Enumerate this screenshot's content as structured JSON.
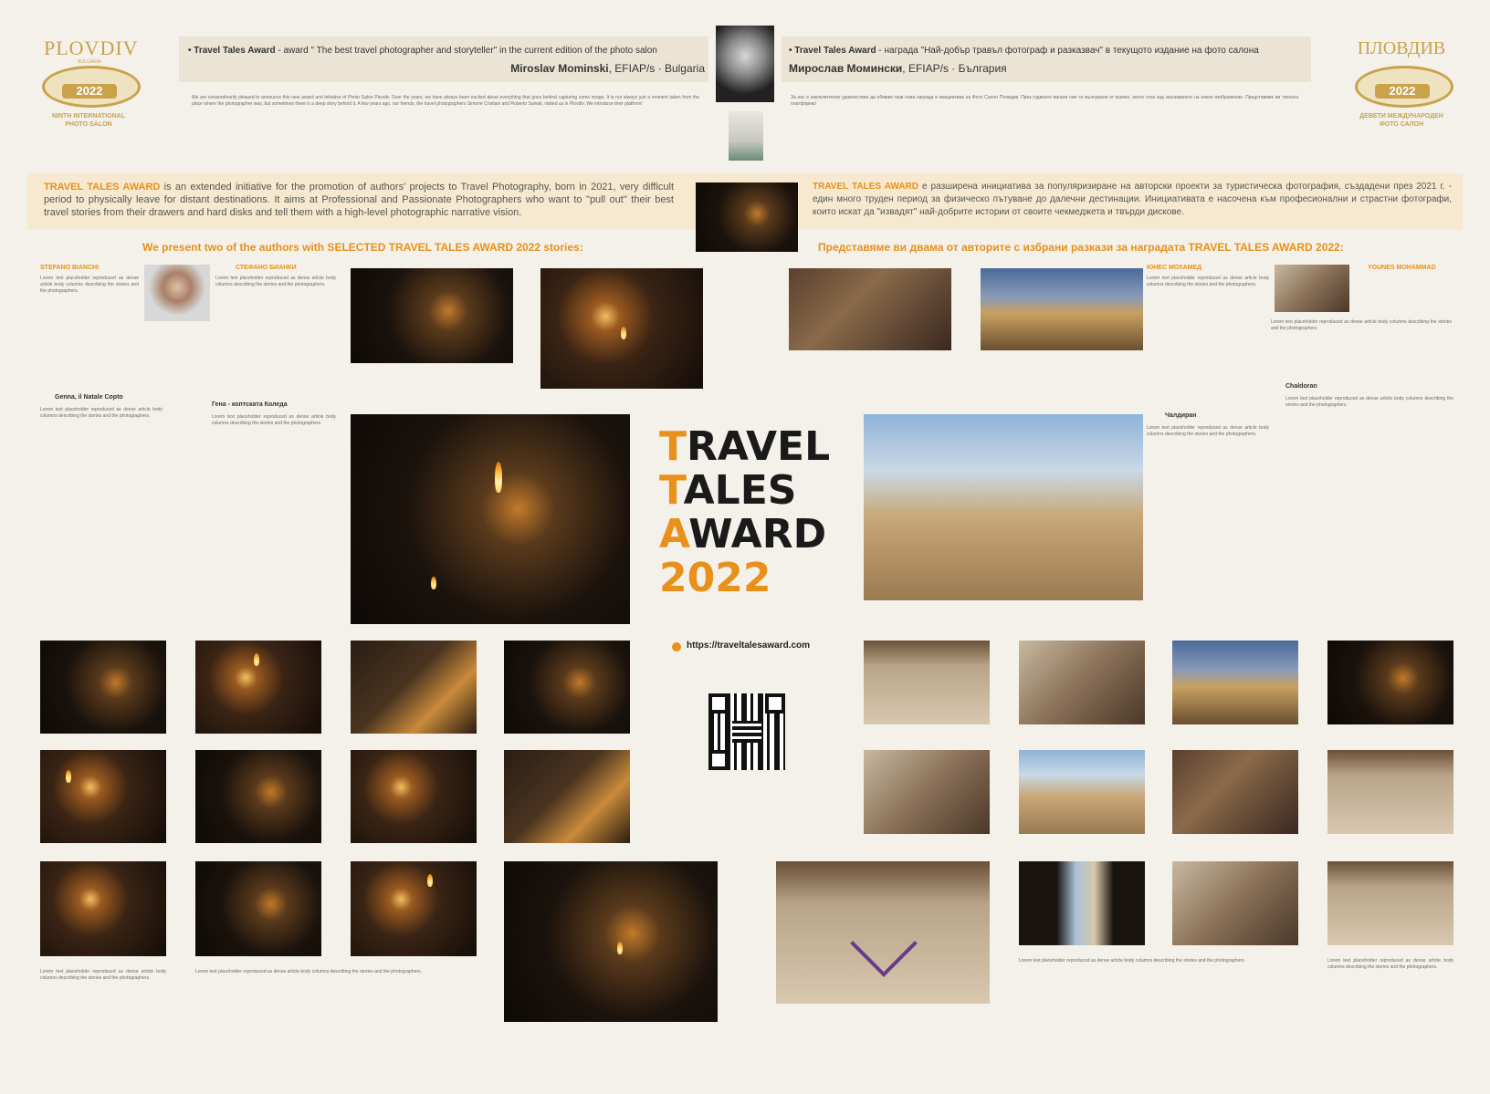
{
  "colors": {
    "accent": "#e8901a",
    "gold": "#c9a24a",
    "dark": "#222222",
    "paper": "#f4f1ea",
    "text": "#6a6a6a"
  },
  "left_logo": {
    "city": "PLOVDIV",
    "country": "BULGARIA",
    "year": "2022",
    "caption_line1": "NINTH INTERNATIONAL",
    "caption_line2": "PHOTO SALON"
  },
  "right_logo": {
    "city": "ПЛОВДИВ",
    "year": "2022",
    "caption_line1": "ДЕВЕТИ МЕЖДУНАРОДЕН",
    "caption_line2": "ФОТО САЛОН"
  },
  "header_en": {
    "award": "• Travel Tales Award",
    "desc": "- award \" The best travel photographer and storyteller\" in the current edition of the photo salon",
    "name": "Miroslav Mominski",
    "title": ", EFIAP/s · Bulgaria"
  },
  "header_bg": {
    "award": "• Travel Tales Award",
    "desc": "- награда \"Най-добър травъл фотограф и разказвач\" в текущото издание на фото салона",
    "name": "Мирослав Момински",
    "title": ", EFIAP/s · България"
  },
  "intro_en": "We are extraordinarily pleased to announce this new award and initiative of Photo Salon Plovdiv. Over the years, we have always been excited about everything that goes behind capturing some image. It is not always just a moment taken from the place where the photographer was, but sometimes there is a deep story behind it. A few years ago, our friends, the travel photographers Simone Cristiani and Roberto Salvati, visited us in Plovdiv. We introduce their platform!",
  "intro_bg": "За нас е изключително удоволствие да обявим тази нова награда и инициатива на Фото Салон Пловдив. През годините винаги сме се вълнували от всичко, което стои зад заснемането на някое изображение. Представяме ви тяхната платформа!",
  "tta_en": {
    "label": "TRAVEL TALES AWARD",
    "text": " is an extended initiative for the promotion of authors' projects to Travel Photography, born in 2021, very difficult period to physically leave for distant destinations. It aims at Professional and Passionate Photographers who want to \"pull out\" their best travel stories from their drawers and hard disks and tell them with a high-level photographic narrative vision."
  },
  "tta_bg": {
    "label": "TRAVEL TALES AWARD",
    "text": " е разширена инициатива за популяризиране на авторски проекти за туристическа фотография, създадени през 2021 г. - един много труден период за физическо пътуване до далечни дестинации. Инициативата е насочена към професионални и страстни фотографи, които искат да \"извадят\" най-добрите истории от своите чекмеджета и твърди дискове."
  },
  "present_en": "We present two of the authors with SELECTED TRAVEL TALES AWARD 2022 stories:",
  "present_bg": "Представяме ви двама от авторите с избрани разкази за наградата TRAVEL TALES AWARD 2022:",
  "author1": {
    "name_en": "STEFANO BIANCHI",
    "name_bg": "СТЕФАНО БИАНКИ",
    "story_en": "Genna, il Natale Copto",
    "story_bg": "Гена - коптската Коледа"
  },
  "author2": {
    "name_bg": "ЮНЕС МОХАМЕД",
    "name_en": "YOUNES MOHAMMAD",
    "story_en": "Chaldoran",
    "story_bg": "Чалдиран"
  },
  "center": {
    "line1_first": "T",
    "line1_rest": "RAVEL",
    "line2_first": "T",
    "line2_rest": "ALES",
    "line3_first": "A",
    "line3_rest": "WARD",
    "year": "2022",
    "url": "https://traveltalesaward.com"
  },
  "filler_text": "Lorem text placeholder reproduced as dense article body columns describing the stories and the photographers."
}
